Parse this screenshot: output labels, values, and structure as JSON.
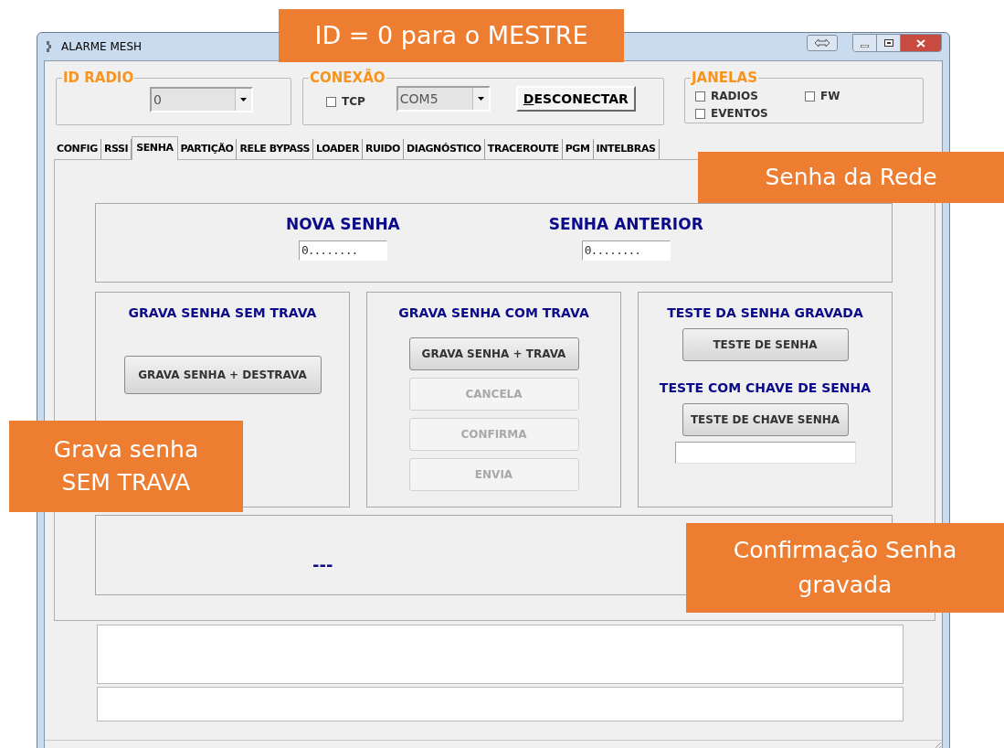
{
  "window": {
    "title": "ALARME MESH"
  },
  "id_radio": {
    "label": "ID RADIO",
    "value": "0"
  },
  "conexao": {
    "label": "CONEXÃO",
    "tcp": {
      "label": "TCP",
      "checked": false
    },
    "port": "COM5",
    "button": "DESCONECTAR"
  },
  "janelas": {
    "label": "JANELAS",
    "options": [
      {
        "label": "RADIOS",
        "checked": false
      },
      {
        "label": "EVENTOS",
        "checked": false
      },
      {
        "label": "FW",
        "checked": false
      }
    ]
  },
  "tabs": [
    {
      "label": "CONFIG",
      "selected": false
    },
    {
      "label": "RSSI",
      "selected": false
    },
    {
      "label": "SENHA",
      "selected": true
    },
    {
      "label": "PARTIÇÃO",
      "selected": false
    },
    {
      "label": "RELE BYPASS",
      "selected": false
    },
    {
      "label": "LOADER",
      "selected": false
    },
    {
      "label": "RUIDO",
      "selected": false
    },
    {
      "label": "DIAGNÓSTICO",
      "selected": false
    },
    {
      "label": "TRACEROUTE",
      "selected": false
    },
    {
      "label": "PGM",
      "selected": false
    },
    {
      "label": "INTELBRAS",
      "selected": false
    }
  ],
  "senha": {
    "nova": {
      "label": "NOVA SENHA",
      "value": "0........"
    },
    "anterior": {
      "label": "SENHA ANTERIOR",
      "value": "0........"
    }
  },
  "panels": [
    {
      "title": "GRAVA SENHA SEM TRAVA",
      "items": [
        {
          "kind": "button",
          "label": "GRAVA SENHA + DESTRAVA",
          "disabled": false
        }
      ]
    },
    {
      "title": "GRAVA SENHA COM TRAVA",
      "items": [
        {
          "kind": "button",
          "label": "GRAVA SENHA + TRAVA",
          "disabled": false
        },
        {
          "kind": "button",
          "label": "CANCELA",
          "disabled": true
        },
        {
          "kind": "button",
          "label": "CONFIRMA",
          "disabled": true
        },
        {
          "kind": "button",
          "label": "ENVIA",
          "disabled": true
        }
      ]
    },
    {
      "title": "TESTE DA SENHA GRAVADA",
      "items": [
        {
          "kind": "button",
          "label": "TESTE DE SENHA",
          "disabled": false
        },
        {
          "kind": "heading",
          "label": "TESTE COM CHAVE DE SENHA"
        },
        {
          "kind": "button",
          "label": "TESTE DE CHAVE SENHA",
          "disabled": false
        },
        {
          "kind": "field"
        }
      ]
    }
  ],
  "status": "---",
  "callouts": [
    "ID = 0 para o MESTRE",
    "Senha da Rede",
    "Grava senha SEM TRAVA",
    "Confirmação Senha gravada"
  ]
}
